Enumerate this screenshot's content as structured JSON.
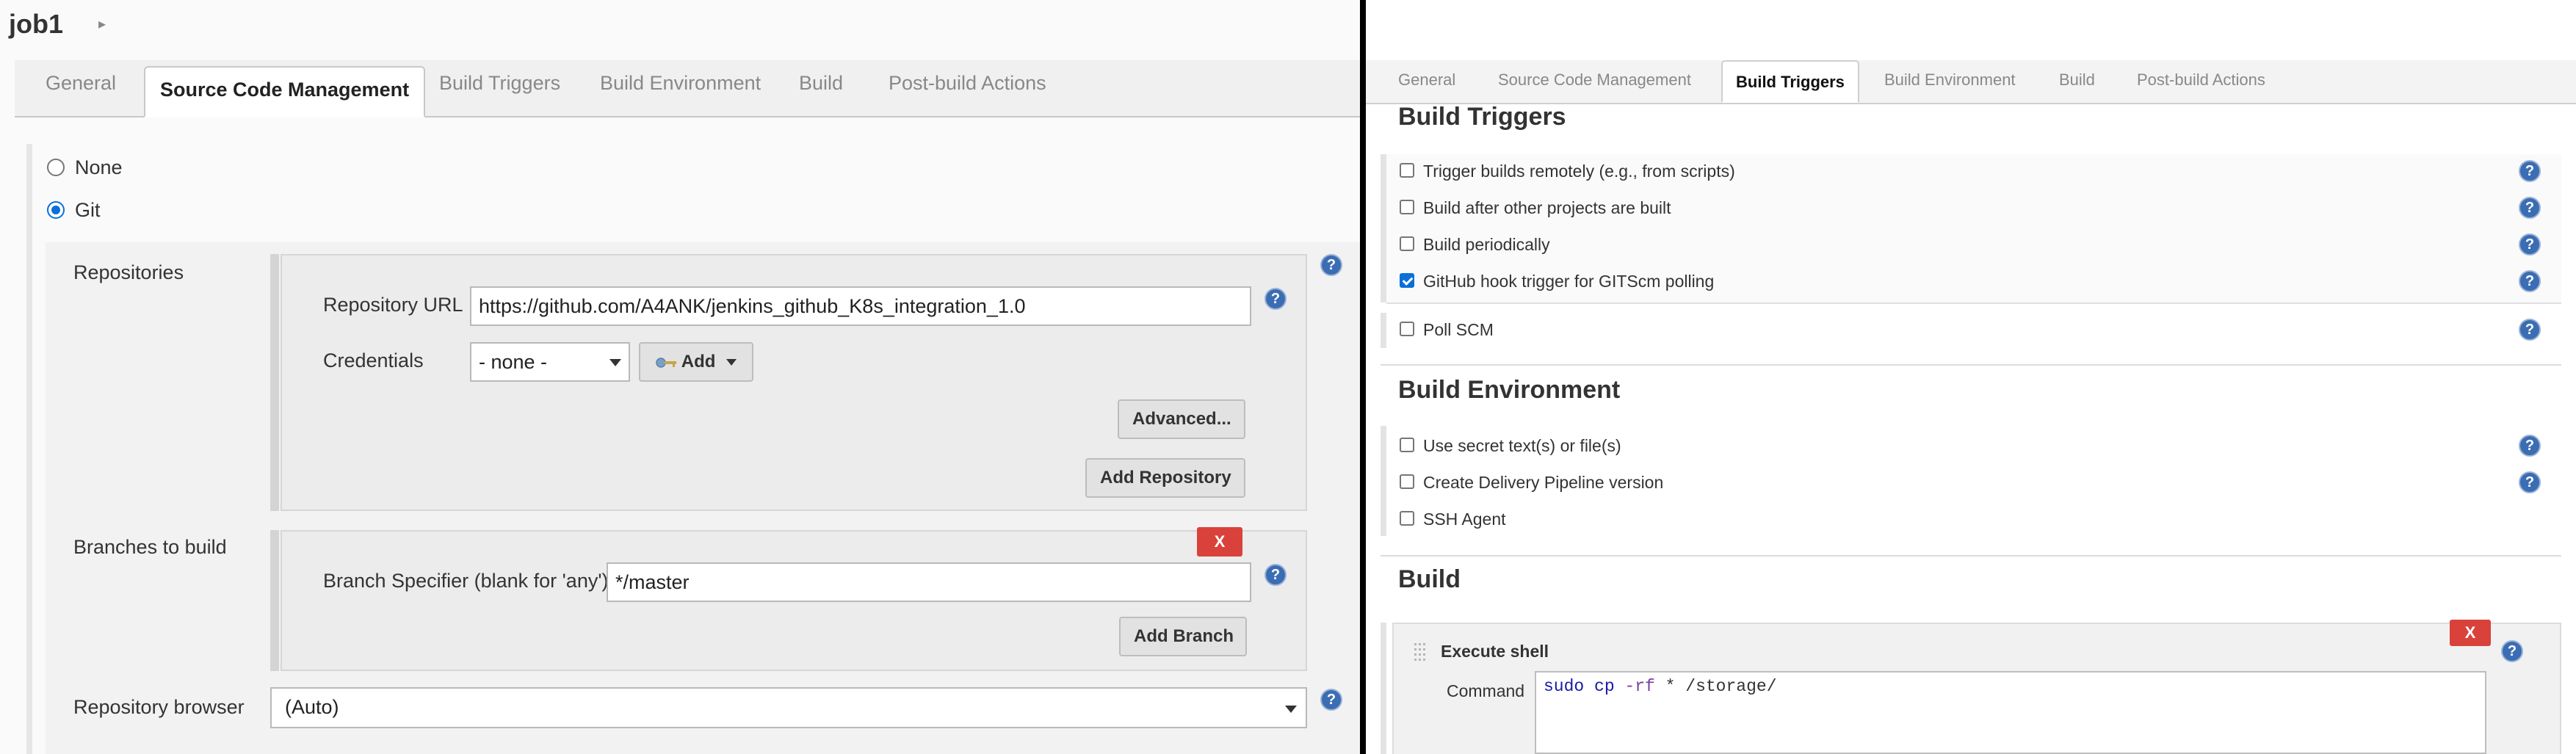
{
  "header": {
    "job_title": "job1",
    "breadcrumb_arrow": "▸"
  },
  "left_tabs": [
    {
      "label": "General"
    },
    {
      "label": "Source Code Management"
    },
    {
      "label": "Build Triggers"
    },
    {
      "label": "Build Environment"
    },
    {
      "label": "Build"
    },
    {
      "label": "Post-build Actions"
    }
  ],
  "scm": {
    "none_label": "None",
    "git_label": "Git",
    "selected": "Git",
    "repositories_label": "Repositories",
    "repo_url_label": "Repository URL",
    "repo_url_value": "https://github.com/A4ANK/jenkins_github_K8s_integration_1.0",
    "credentials_label": "Credentials",
    "credentials_value": "- none -",
    "add_label": "Add",
    "advanced_label": "Advanced...",
    "add_repository_label": "Add Repository",
    "branches_label": "Branches to build",
    "delete_label": "X",
    "branch_spec_label": "Branch Specifier (blank for 'any')",
    "branch_spec_value": "*/master",
    "add_branch_label": "Add Branch",
    "repo_browser_label": "Repository browser",
    "repo_browser_value": "(Auto)"
  },
  "right_tabs": [
    {
      "label": "General"
    },
    {
      "label": "Source Code Management"
    },
    {
      "label": "Build Triggers"
    },
    {
      "label": "Build Environment"
    },
    {
      "label": "Build"
    },
    {
      "label": "Post-build Actions"
    }
  ],
  "build_triggers": {
    "title": "Build Triggers",
    "options": [
      {
        "label": "Trigger builds remotely (e.g., from scripts)",
        "checked": false
      },
      {
        "label": "Build after other projects are built",
        "checked": false
      },
      {
        "label": "Build periodically",
        "checked": false
      },
      {
        "label": "GitHub hook trigger for GITScm polling",
        "checked": true
      },
      {
        "label": "Poll SCM",
        "checked": false
      }
    ]
  },
  "build_environment": {
    "title": "Build Environment",
    "options": [
      {
        "label": "Use secret text(s) or file(s)",
        "checked": false
      },
      {
        "label": "Create Delivery Pipeline version",
        "checked": false
      },
      {
        "label": "SSH Agent",
        "checked": false
      }
    ]
  },
  "build": {
    "title": "Build",
    "step_title": "Execute shell",
    "delete_label": "X",
    "command_label": "Command",
    "command_parts": {
      "cmd": "sudo cp",
      "flag": "-rf",
      "rest": "* /storage/"
    }
  },
  "help_glyph": "?",
  "icons": {
    "help": "help-icon",
    "key": "key-icon",
    "drag": "drag-handle-icon"
  },
  "colors": {
    "help_blue": "#3b6db3",
    "delete_red": "#d9423b",
    "checkbox_blue": "#0a6fd8"
  }
}
